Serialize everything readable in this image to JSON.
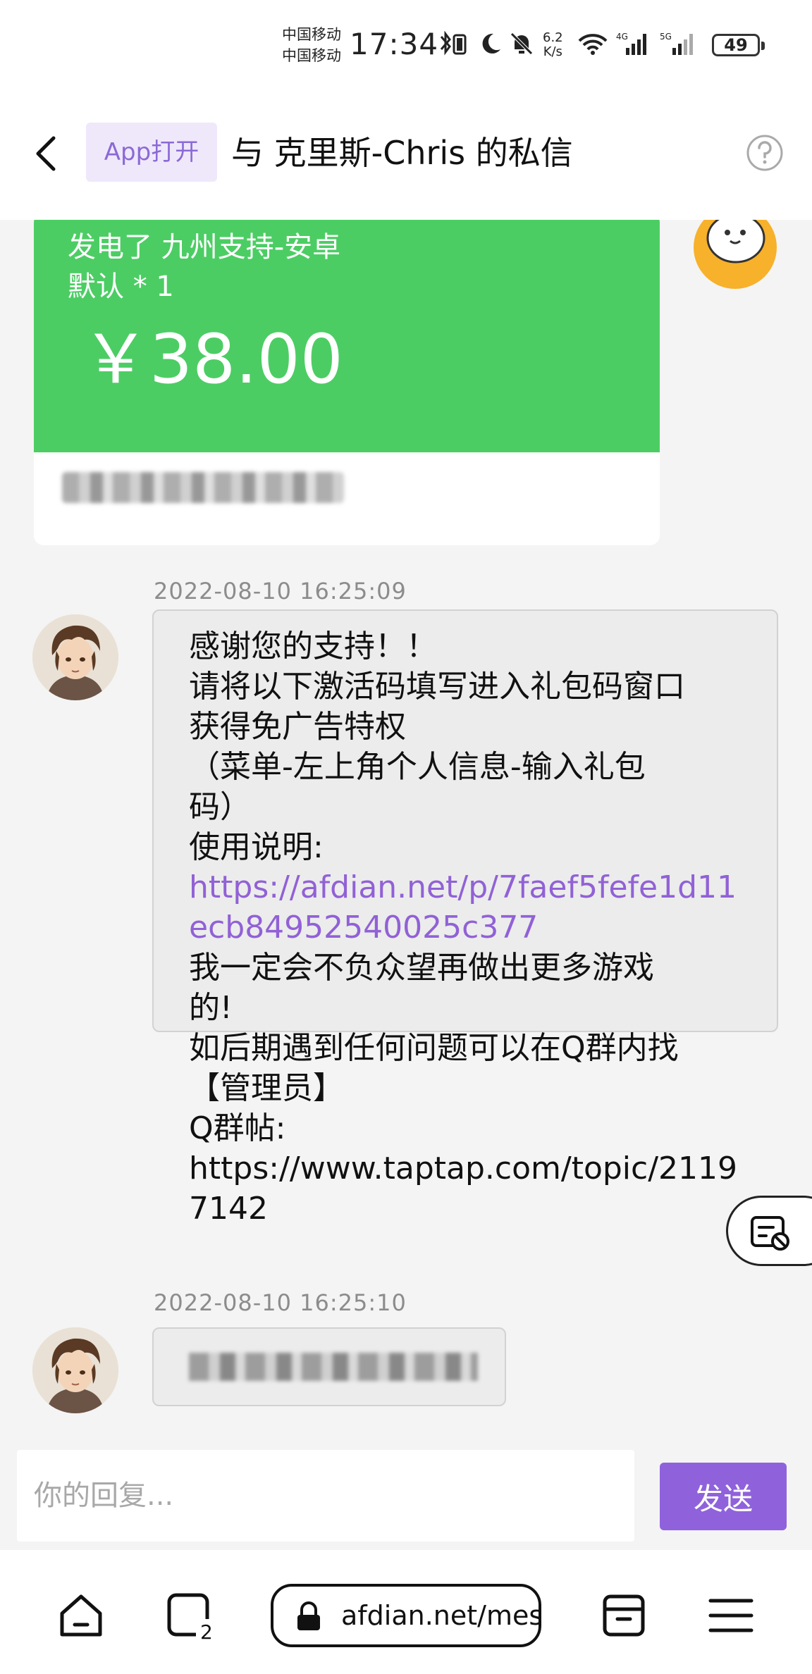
{
  "status_bar": {
    "carrier1": "中国移动",
    "carrier2": "中国移动",
    "time": "17:34",
    "net_speed_value": "6.2",
    "net_speed_unit": "K/s",
    "battery": "49"
  },
  "header": {
    "app_open_label": "App打开",
    "title": "与 克里斯-Chris 的私信"
  },
  "payment_card": {
    "line1": "发电了 九州支持-安卓",
    "line2": "默认 * 1",
    "amount": "￥38.00",
    "color": "#4ccd64"
  },
  "messages": [
    {
      "timestamp": "2022-08-10 16:25:09",
      "lines": [
        {
          "text": "感谢您的支持！！",
          "link": false
        },
        {
          "text": "请将以下激活码填写进入礼包码窗口",
          "link": false
        },
        {
          "text": "获得免广告特权",
          "link": false
        },
        {
          "text": "（菜单-左上角个人信息-输入礼包",
          "link": false
        },
        {
          "text": "码）",
          "link": false
        },
        {
          "text": "使用说明:",
          "link": false
        },
        {
          "text": "https://afdian.net/p/7faef5fefe1d11",
          "link": true
        },
        {
          "text": "ecb84952540025c377",
          "link": true
        },
        {
          "text": "我一定会不负众望再做出更多游戏",
          "link": false
        },
        {
          "text": "的!",
          "link": false
        },
        {
          "text": "如后期遇到任何问题可以在Q群内找",
          "link": false
        },
        {
          "text": "【管理员】",
          "link": false
        },
        {
          "text": "Q群帖:",
          "link": false
        },
        {
          "text": "https://www.taptap.com/topic/2119",
          "link": false
        },
        {
          "text": "7142",
          "link": false
        }
      ]
    },
    {
      "timestamp": "2022-08-10 16:25:10",
      "lines": []
    }
  ],
  "reply": {
    "placeholder": "你的回复...",
    "send_label": "发送"
  },
  "browser": {
    "url": "afdian.net/mes",
    "tab_count": "2"
  },
  "colors": {
    "accent_purple": "#8f62dc",
    "link_purple": "#9161d6"
  }
}
